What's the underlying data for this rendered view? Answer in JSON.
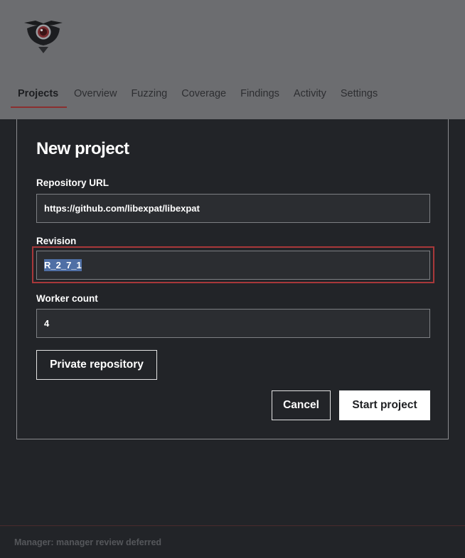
{
  "nav": {
    "items": [
      {
        "label": "Projects",
        "active": true
      },
      {
        "label": "Overview",
        "active": false
      },
      {
        "label": "Fuzzing",
        "active": false
      },
      {
        "label": "Coverage",
        "active": false
      },
      {
        "label": "Findings",
        "active": false
      },
      {
        "label": "Activity",
        "active": false
      },
      {
        "label": "Settings",
        "active": false
      }
    ]
  },
  "logo": {
    "icon": "owl-eye-icon"
  },
  "form": {
    "title": "New project",
    "repo_label": "Repository URL",
    "repo_value": "https://github.com/libexpat/libexpat",
    "revision_label": "Revision",
    "revision_value": "R_2_7_1",
    "worker_label": "Worker count",
    "worker_value": "4",
    "private_button": "Private repository",
    "cancel_button": "Cancel",
    "start_button": "Start project"
  },
  "footer": {
    "status": "Manager: manager review deferred"
  },
  "colors": {
    "header_bg": "#6c6d70",
    "page_bg": "#222428",
    "accent": "#a8383a"
  }
}
